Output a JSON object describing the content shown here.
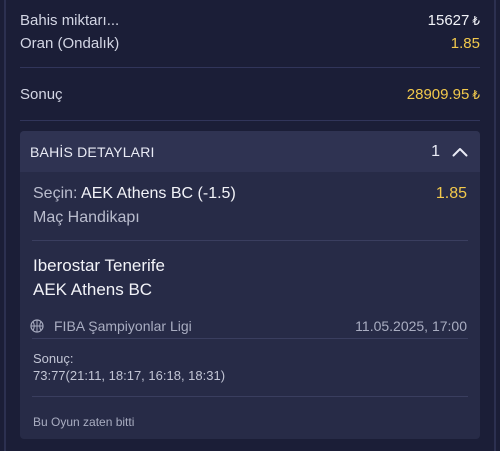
{
  "summary": {
    "stake_label": "Bahis miktarı...",
    "stake_value": "15627",
    "odds_label": "Oran (Ondalık)",
    "odds_value": "1.85",
    "result_label": "Sonuç",
    "result_value": "28909.95",
    "currency_symbol": "₺"
  },
  "details": {
    "title": "BAHİS DETAYLARI",
    "count": "1",
    "toggle_icon": "chevron-up-icon",
    "selection_label": "Seçin:",
    "selection_value": "AEK Athens BC (-1.5)",
    "odds": "1.85",
    "market": "Maç Handikapı",
    "home_team": "Iberostar Tenerife",
    "away_team": "AEK Athens BC",
    "sport_icon": "basketball-icon",
    "league": "FIBA Şampiyonlar Ligi",
    "date": "11.05.2025, 17:00",
    "score_label": "Sonuç:",
    "score_value": "73:77(21:11, 18:17, 16:18, 18:31)",
    "status": "Bu Oyun zaten bitti"
  },
  "colors": {
    "background": "#1b1e37",
    "card": "#272b47",
    "card_header": "#2f3352",
    "accent_yellow": "#f2c94c"
  }
}
